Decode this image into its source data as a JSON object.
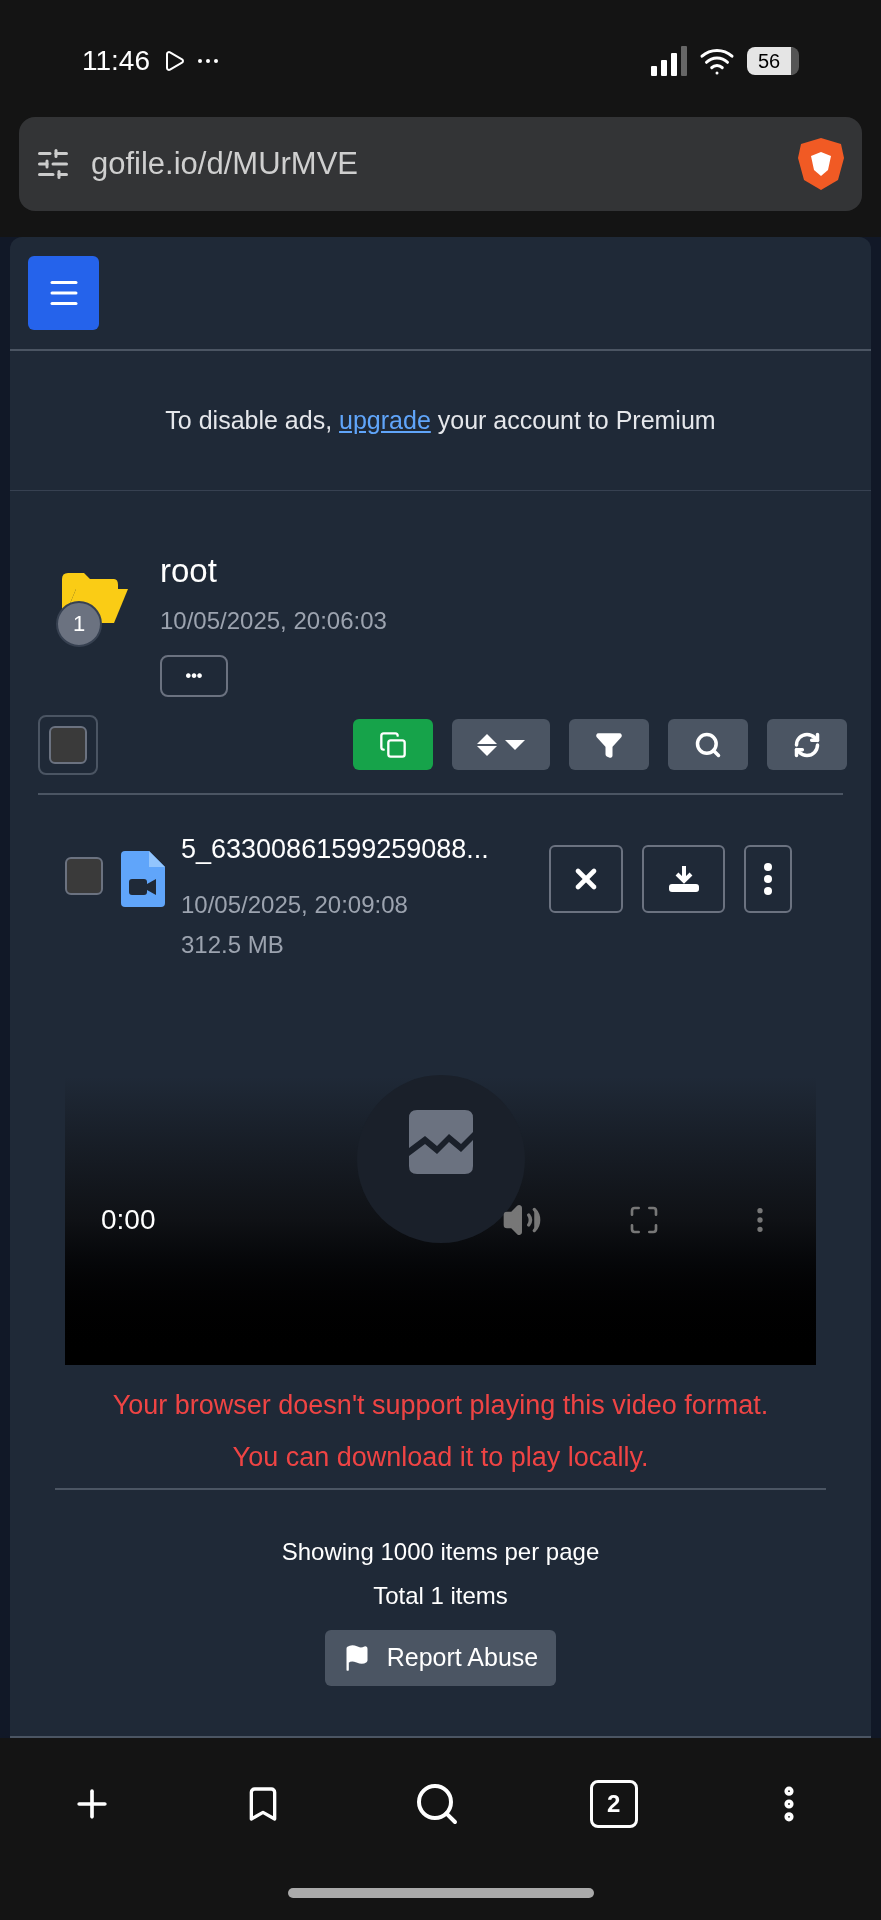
{
  "status_bar": {
    "time": "11:46",
    "battery": "56"
  },
  "address_bar": {
    "url": "gofile.io/d/MUrMVE"
  },
  "ad_notice": {
    "before": "To disable ads, ",
    "link": "upgrade",
    "after": " your account to Premium"
  },
  "folder": {
    "name": "root",
    "date": "10/05/2025, 20:06:03",
    "count": "1",
    "more": "•••"
  },
  "toolbar": {
    "select_all": {
      "checked": false
    }
  },
  "files": [
    {
      "name": "5_63300861599259088...",
      "date": "10/05/2025, 20:09:08",
      "size": "312.5 MB",
      "checked": false
    }
  ],
  "player": {
    "time": "0:00"
  },
  "error": [
    "Your browser doesn't support playing this video format.",
    "You can download it to play locally."
  ],
  "footer": {
    "per_page": "Showing 1000 items per page",
    "total": "Total 1 items",
    "report": "Report Abuse"
  },
  "bottom_nav": {
    "tabs": "2"
  }
}
